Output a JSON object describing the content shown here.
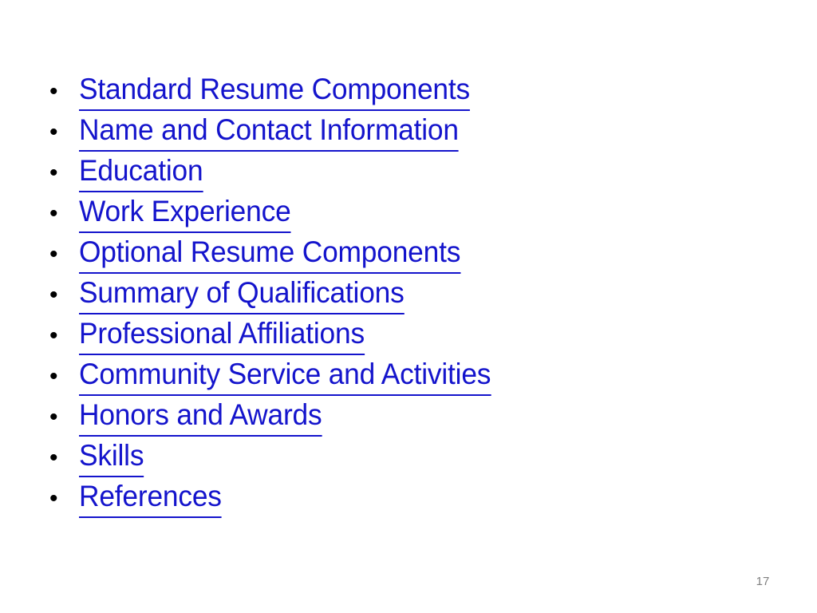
{
  "slide": {
    "background_color": "#ffffff",
    "link_color": "#1414cc",
    "bullet_color": "#000000",
    "page_number_color": "#808080",
    "bullet_glyph": "•",
    "bullet_icon_name": "bullet-dot-icon"
  },
  "bullets": [
    {
      "label": "Standard Resume Components"
    },
    {
      "label": "Name and Contact Information"
    },
    {
      "label": "Education"
    },
    {
      "label": "Work Experience"
    },
    {
      "label": "Optional Resume Components"
    },
    {
      "label": "Summary of Qualifications"
    },
    {
      "label": "Professional Affiliations"
    },
    {
      "label": "Community Service and Activities"
    },
    {
      "label": "Honors and Awards"
    },
    {
      "label": "Skills"
    },
    {
      "label": "References"
    }
  ],
  "footer": {
    "page_number": "17"
  }
}
